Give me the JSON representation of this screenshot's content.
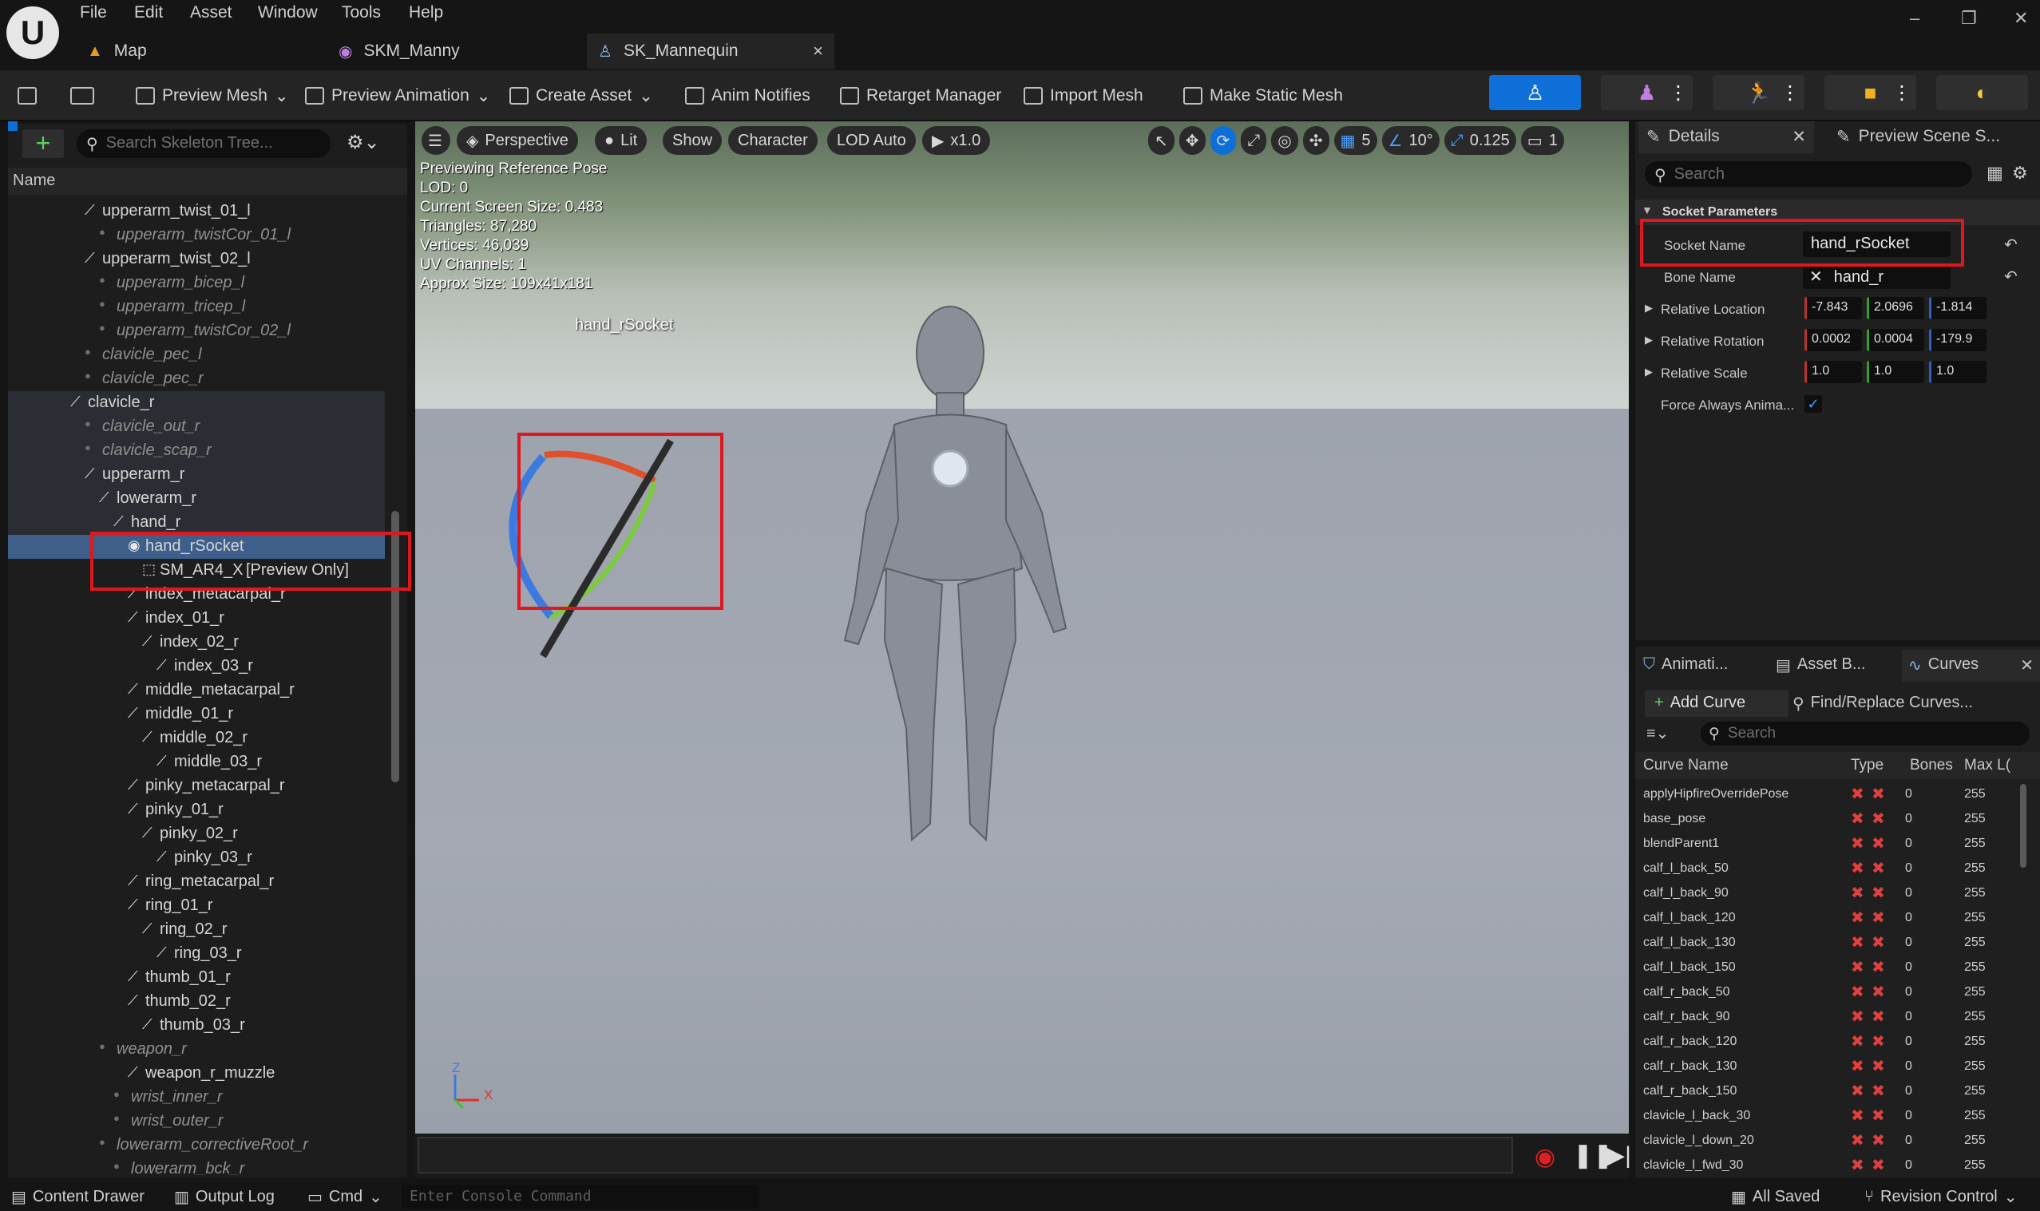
{
  "menu": [
    "File",
    "Edit",
    "Asset",
    "Window",
    "Tools",
    "Help"
  ],
  "tabs": [
    {
      "label": "Map"
    },
    {
      "label": "SKM_Manny"
    },
    {
      "label": "SK_Mannequin",
      "close": "×"
    }
  ],
  "window_controls": {
    "minimize": "–",
    "restore": "❐",
    "close": "✕"
  },
  "toolbar": {
    "preview_mesh": "Preview Mesh",
    "preview_animation": "Preview Animation",
    "create_asset": "Create Asset",
    "anim_notifies": "Anim Notifies",
    "retarget_manager": "Retarget Manager",
    "import_mesh": "Import Mesh",
    "make_static_mesh": "Make Static Mesh"
  },
  "skeleton_tree": {
    "search_placeholder": "Search Skeleton Tree...",
    "header": "Name",
    "add": "+",
    "rows": [
      {
        "label": "upperarm_twist_01_l",
        "virtual": false
      },
      {
        "label": "upperarm_twistCor_01_l",
        "virtual": true
      },
      {
        "label": "upperarm_twist_02_l",
        "virtual": false
      },
      {
        "label": "upperarm_bicep_l",
        "virtual": true
      },
      {
        "label": "upperarm_tricep_l",
        "virtual": true
      },
      {
        "label": "upperarm_twistCor_02_l",
        "virtual": true
      },
      {
        "label": "clavicle_pec_l",
        "virtual": true
      },
      {
        "label": "clavicle_pec_r",
        "virtual": true
      },
      {
        "label": "clavicle_r",
        "virtual": false
      },
      {
        "label": "clavicle_out_r",
        "virtual": true
      },
      {
        "label": "clavicle_scap_r",
        "virtual": true
      },
      {
        "label": "upperarm_r",
        "virtual": false
      },
      {
        "label": "lowerarm_r",
        "virtual": false
      },
      {
        "label": "hand_r",
        "virtual": false
      },
      {
        "label": "hand_rSocket",
        "virtual": false
      },
      {
        "label": "SM_AR4_X",
        "virtual": false
      },
      {
        "label": "index_metacarpal_r",
        "virtual": false
      },
      {
        "label": "index_01_r",
        "virtual": false
      },
      {
        "label": "index_02_r",
        "virtual": false
      },
      {
        "label": "index_03_r",
        "virtual": false
      },
      {
        "label": "middle_metacarpal_r",
        "virtual": false
      },
      {
        "label": "middle_01_r",
        "virtual": false
      },
      {
        "label": "middle_02_r",
        "virtual": false
      },
      {
        "label": "middle_03_r",
        "virtual": false
      },
      {
        "label": "pinky_metacarpal_r",
        "virtual": false
      },
      {
        "label": "pinky_01_r",
        "virtual": false
      },
      {
        "label": "pinky_02_r",
        "virtual": false
      },
      {
        "label": "pinky_03_r",
        "virtual": false
      },
      {
        "label": "ring_metacarpal_r",
        "virtual": false
      },
      {
        "label": "ring_01_r",
        "virtual": false
      },
      {
        "label": "ring_02_r",
        "virtual": false
      },
      {
        "label": "ring_03_r",
        "virtual": false
      },
      {
        "label": "thumb_01_r",
        "virtual": false
      },
      {
        "label": "thumb_02_r",
        "virtual": false
      },
      {
        "label": "thumb_03_r",
        "virtual": false
      },
      {
        "label": "weapon_r",
        "virtual": true
      },
      {
        "label": "weapon_r_muzzle",
        "virtual": false
      },
      {
        "label": "wrist_inner_r",
        "virtual": true
      },
      {
        "label": "wrist_outer_r",
        "virtual": true
      },
      {
        "label": "lowerarm_correctiveRoot_r",
        "virtual": true
      },
      {
        "label": "lowerarm_bck_r",
        "virtual": true
      }
    ],
    "preview_tag": "[Preview Only]"
  },
  "viewport": {
    "buttons": {
      "perspective": "Perspective",
      "lit": "Lit",
      "show": "Show",
      "character": "Character",
      "lod": "LOD Auto",
      "speed": "x1.0"
    },
    "right_values": {
      "grid": "5",
      "angle": "10°",
      "scale": "0.125",
      "cam": "1"
    },
    "info": [
      "Previewing Reference Pose",
      "LOD: 0",
      "Current Screen Size: 0.483",
      "Triangles: 87,280",
      "Vertices: 46,039",
      "UV Channels: 1",
      "Approx Size: 109x41x181"
    ],
    "socket_label": "hand_rSocket",
    "axis_z": "Z",
    "axis_x": "X"
  },
  "details": {
    "tab1": "Details",
    "tab2": "Preview Scene S...",
    "search_placeholder": "Search",
    "section": "Socket Parameters",
    "socket_name_label": "Socket Name",
    "socket_name": "hand_rSocket",
    "bone_name_label": "Bone Name",
    "bone_name": "hand_r",
    "location_label": "Relative Location",
    "location": [
      "-7.843",
      "2.0696",
      "-1.814"
    ],
    "rotation_label": "Relative Rotation",
    "rotation": [
      "0.0002",
      "0.0004",
      "-179.9"
    ],
    "scale_label": "Relative Scale",
    "scale": [
      "1.0",
      "1.0",
      "1.0"
    ],
    "force_label": "Force Always Anima..."
  },
  "curves_panel": {
    "tabs": [
      "Animati...",
      "Asset B...",
      "Curves"
    ],
    "add_curve": "Add Curve",
    "find_replace": "Find/Replace Curves...",
    "search_placeholder": "Search",
    "headers": [
      "Curve Name",
      "Type",
      "Bones",
      "Max L("
    ],
    "rows": [
      {
        "name": "applyHipfireOverridePose",
        "bones": "0",
        "max": "255"
      },
      {
        "name": "base_pose",
        "bones": "0",
        "max": "255"
      },
      {
        "name": "blendParent1",
        "bones": "0",
        "max": "255"
      },
      {
        "name": "calf_l_back_50",
        "bones": "0",
        "max": "255"
      },
      {
        "name": "calf_l_back_90",
        "bones": "0",
        "max": "255"
      },
      {
        "name": "calf_l_back_120",
        "bones": "0",
        "max": "255"
      },
      {
        "name": "calf_l_back_130",
        "bones": "0",
        "max": "255"
      },
      {
        "name": "calf_l_back_150",
        "bones": "0",
        "max": "255"
      },
      {
        "name": "calf_r_back_50",
        "bones": "0",
        "max": "255"
      },
      {
        "name": "calf_r_back_90",
        "bones": "0",
        "max": "255"
      },
      {
        "name": "calf_r_back_120",
        "bones": "0",
        "max": "255"
      },
      {
        "name": "calf_r_back_130",
        "bones": "0",
        "max": "255"
      },
      {
        "name": "calf_r_back_150",
        "bones": "0",
        "max": "255"
      },
      {
        "name": "clavicle_l_back_30",
        "bones": "0",
        "max": "255"
      },
      {
        "name": "clavicle_l_down_20",
        "bones": "0",
        "max": "255"
      },
      {
        "name": "clavicle_l_fwd_30",
        "bones": "0",
        "max": "255"
      }
    ]
  },
  "statusbar": {
    "content_drawer": "Content Drawer",
    "output_log": "Output Log",
    "cmd": "Cmd",
    "console_placeholder": "Enter Console Command",
    "saved": "All Saved",
    "revision": "Revision Control"
  },
  "colors": {
    "accent": "#0e6fd8",
    "selection": "#3d5f8a",
    "highlight_box": "#e0171e"
  }
}
